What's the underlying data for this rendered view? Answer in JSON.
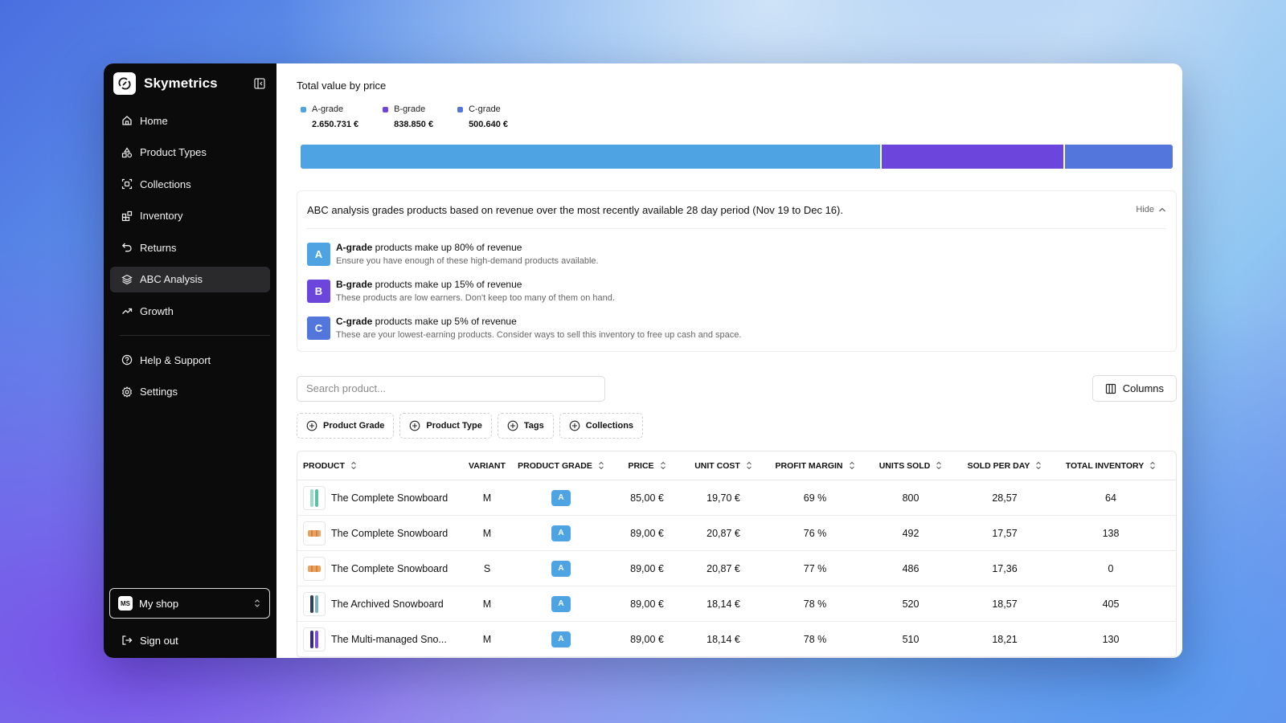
{
  "colors": {
    "a_grade": "#4ea3e3",
    "b_grade": "#6c46dc",
    "c_grade": "#5276dc",
    "sidebar_bg": "#0b0b0c"
  },
  "sidebar": {
    "brand": "Skymetrics",
    "items": [
      {
        "label": "Home",
        "icon": "home-icon"
      },
      {
        "label": "Product Types",
        "icon": "shapes-icon"
      },
      {
        "label": "Collections",
        "icon": "scan-icon"
      },
      {
        "label": "Inventory",
        "icon": "blocks-icon"
      },
      {
        "label": "Returns",
        "icon": "undo-icon"
      },
      {
        "label": "ABC Analysis",
        "icon": "layers-icon",
        "active": true
      },
      {
        "label": "Growth",
        "icon": "trend-up-icon"
      }
    ],
    "secondary": [
      {
        "label": "Help & Support",
        "icon": "help-icon"
      },
      {
        "label": "Settings",
        "icon": "gear-icon"
      }
    ],
    "shop": {
      "initials": "MS",
      "name": "My shop"
    },
    "signout": "Sign out"
  },
  "value_section": {
    "title": "Total value by price",
    "legend": [
      {
        "label": "A-grade",
        "value": "2.650.731 €"
      },
      {
        "label": "B-grade",
        "value": "838.850 €"
      },
      {
        "label": "C-grade",
        "value": "500.640 €"
      }
    ]
  },
  "chart_data": {
    "type": "bar",
    "title": "Total value by price",
    "categories": [
      "A-grade",
      "B-grade",
      "C-grade"
    ],
    "values": [
      2650731,
      838850,
      500640
    ],
    "stacked": true,
    "orientation": "horizontal",
    "legend": "top-left"
  },
  "info": {
    "heading": "ABC analysis grades products based on revenue over the most recently available 28 day period (Nov 19 to Dec 16).",
    "hide_label": "Hide",
    "grades": [
      {
        "letter": "A",
        "title": "A-grade",
        "rest": " products make up 80% of revenue",
        "desc": "Ensure you have enough of these high-demand products available."
      },
      {
        "letter": "B",
        "title": "B-grade",
        "rest": " products make up 15% of revenue",
        "desc": "These products are low earners. Don't keep too many of them on hand."
      },
      {
        "letter": "C",
        "title": "C-grade",
        "rest": " products make up 5% of revenue",
        "desc": "These are your lowest-earning products. Consider ways to sell this inventory to free up cash and space."
      }
    ]
  },
  "search": {
    "placeholder": "Search product..."
  },
  "columns_label": "Columns",
  "filters": [
    "Product Grade",
    "Product Type",
    "Tags",
    "Collections"
  ],
  "table": {
    "headers": {
      "product": "PRODUCT",
      "variant": "VARIANT",
      "grade": "PRODUCT GRADE",
      "price": "PRICE",
      "cost": "UNIT COST",
      "margin": "PROFIT MARGIN",
      "units": "UNITS SOLD",
      "per_day": "SOLD PER DAY",
      "inventory": "TOTAL INVENTORY"
    },
    "rows": [
      {
        "product": "The Complete Snowboard",
        "variant": "M",
        "grade": "A",
        "price": "85,00 €",
        "cost": "19,70 €",
        "margin": "69 %",
        "units": "800",
        "per_day": "28,57",
        "inventory": "64",
        "thumb": "teal"
      },
      {
        "product": "The Complete Snowboard",
        "variant": "M",
        "grade": "A",
        "price": "89,00 €",
        "cost": "20,87 €",
        "margin": "76 %",
        "units": "492",
        "per_day": "17,57",
        "inventory": "138",
        "thumb": "orange"
      },
      {
        "product": "The Complete Snowboard",
        "variant": "S",
        "grade": "A",
        "price": "89,00 €",
        "cost": "20,87 €",
        "margin": "77 %",
        "units": "486",
        "per_day": "17,36",
        "inventory": "0",
        "thumb": "orange"
      },
      {
        "product": "The Archived Snowboard",
        "variant": "M",
        "grade": "A",
        "price": "89,00 €",
        "cost": "18,14 €",
        "margin": "78 %",
        "units": "520",
        "per_day": "18,57",
        "inventory": "405",
        "thumb": "dark"
      },
      {
        "product": "The Multi-managed Sno...",
        "variant": "M",
        "grade": "A",
        "price": "89,00 €",
        "cost": "18,14 €",
        "margin": "78 %",
        "units": "510",
        "per_day": "18,21",
        "inventory": "130",
        "thumb": "purple"
      }
    ]
  }
}
